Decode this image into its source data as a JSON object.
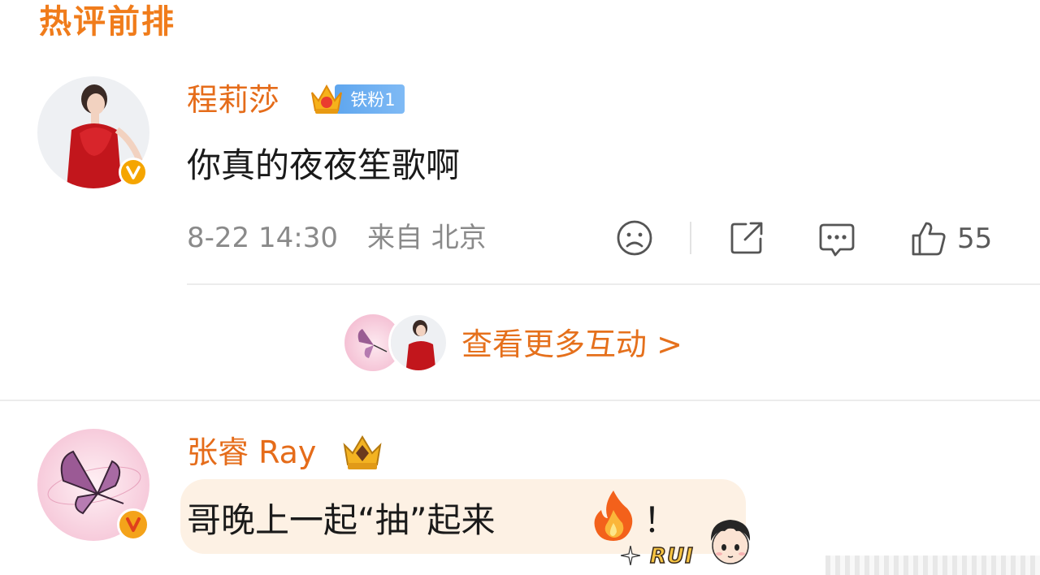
{
  "header": {
    "title": "热评前排"
  },
  "comments": [
    {
      "username": "程莉莎",
      "fan_badge": "铁粉1",
      "text": "你真的夜夜笙歌啊",
      "time": "8-22 14:30",
      "location": "来自 北京",
      "likes": "55"
    },
    {
      "username": "张睿 Ray",
      "text": "哥晚上一起“抽”起来",
      "emoji": "🔥",
      "text_end": "！",
      "sticker_label": "RUI"
    }
  ],
  "more_interactions": {
    "label": "查看更多互动 >"
  },
  "icons": [
    "sad-face-icon",
    "share-icon",
    "comment-icon",
    "thumbs-up-icon",
    "crown-icon",
    "verified-v-icon",
    "fire-icon"
  ],
  "colors": {
    "accent": "#e5701c",
    "verified": "#f5a500",
    "badge_blue": "#5fa6ee"
  }
}
